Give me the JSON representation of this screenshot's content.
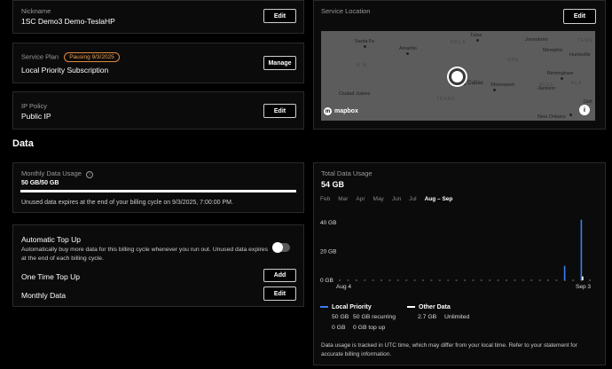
{
  "nickname": {
    "label": "Nickname",
    "value": "1SC Demo3 Demo-TeslaHP",
    "edit_label": "Edit"
  },
  "service_plan": {
    "label": "Service Plan",
    "badge": "Pausing 9/3/2025",
    "value": "Local Priority Subscription",
    "manage_label": "Manage"
  },
  "ip_policy": {
    "label": "IP Policy",
    "value": "Public IP",
    "edit_label": "Edit"
  },
  "service_location": {
    "label": "Service Location",
    "edit_label": "Edit",
    "map": {
      "attribution": "mapbox",
      "cities": [
        "Tulsa",
        "Santa Fe",
        "Amarillo",
        "OKLA",
        "Jonesboro",
        "Memphis",
        "Huntsville",
        "Birmingham",
        "Dallas",
        "Shreveport",
        "Jackson",
        "Ciudad Juárez",
        "TEXAS",
        "New Orleans",
        "N.M",
        "MISS",
        "ALA",
        "ARK",
        "TENN",
        "Delt"
      ]
    }
  },
  "section_title": "Data",
  "monthly_usage": {
    "label": "Monthly Data Usage",
    "amount": "50 GB/50 GB",
    "used_fraction": 1.0,
    "note": "Unused data expires at the end of your billing cycle on 9/3/2025, 7:00:00 PM."
  },
  "top_up": {
    "title": "Automatic Top Up",
    "description": "Automatically buy more data for this billing cycle whenever you run out. Unused data expires at the end of each billing cycle.",
    "enabled": false,
    "one_time_label": "One Time Top Up",
    "add_label": "Add",
    "monthly_label": "Monthly Data",
    "edit_label": "Edit"
  },
  "total_usage": {
    "label": "Total Data Usage",
    "value": "54 GB",
    "months": [
      "Feb",
      "Mar",
      "Apr",
      "May",
      "Jun",
      "Jul",
      "Aug – Sep"
    ],
    "active_month": "Aug – Sep",
    "footnote": "Data usage is tracked in UTC time, which may differ from your local time. Refer to your statement for accurate billing information."
  },
  "legend": {
    "local": {
      "name": "Local Priority",
      "color": "#3d7bf2",
      "row1_amount": "50 GB",
      "row1_desc": "50 GB recurring",
      "row2_amount": "0 GB",
      "row2_desc": "0 GB top up"
    },
    "other": {
      "name": "Other Data",
      "color": "#ffffff",
      "amount": "2.7 GB",
      "desc": "Unlimited"
    }
  },
  "chart_data": {
    "type": "bar",
    "ylim": [
      0,
      40
    ],
    "yticks": [
      "40 GB",
      "20 GB",
      "0 GB"
    ],
    "ytick_values": [
      40,
      20,
      0
    ],
    "x_start_label": "Aug 4",
    "x_end_label": "Sep 3",
    "days": 31,
    "series": [
      {
        "name": "Local Priority",
        "color": "#3d7bf2",
        "values": [
          0,
          0,
          0,
          0,
          0,
          0,
          0,
          0,
          0,
          0,
          0,
          0,
          0,
          0,
          0,
          0,
          0,
          0,
          0,
          0,
          0,
          0,
          0,
          0,
          0,
          0,
          0,
          10,
          0,
          42,
          0
        ]
      },
      {
        "name": "Other Data",
        "color": "#ffffff",
        "values": [
          0,
          0,
          0,
          0,
          0,
          0,
          0,
          0,
          0,
          0,
          0,
          0,
          0,
          0,
          0,
          0,
          0,
          0,
          0,
          0,
          0,
          0,
          0,
          0,
          0,
          0,
          0,
          0,
          0,
          2.7,
          0
        ]
      }
    ]
  }
}
